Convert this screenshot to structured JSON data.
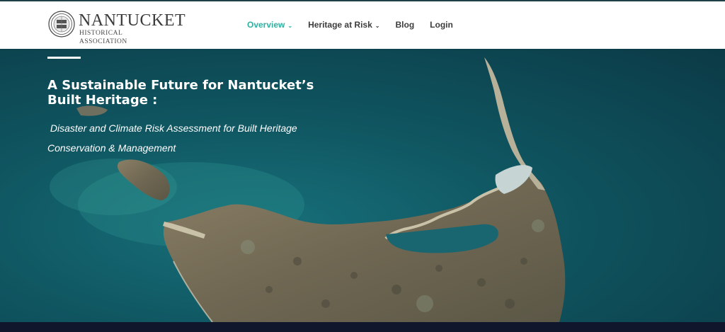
{
  "brand": {
    "name": "NANTUCKET",
    "subtitle": "HISTORICAL ASSOCIATION",
    "seal_icon": "nha-seal-icon"
  },
  "nav": {
    "items": [
      {
        "label": "Overview",
        "dropdown": true,
        "active": true
      },
      {
        "label": "Heritage at Risk",
        "dropdown": true,
        "active": false
      },
      {
        "label": "Blog",
        "dropdown": false,
        "active": false
      },
      {
        "label": "Login",
        "dropdown": false,
        "active": false
      }
    ]
  },
  "hero": {
    "title": "A Sustainable Future for Nantucket’s Built Heritage :",
    "subtitle_line1": " Disaster and Climate Risk Assessment for Built Heritage",
    "subtitle_line2": "Conservation & Management"
  },
  "colors": {
    "accent": "#2fb0a0",
    "nav_text": "#3d3d3d",
    "sea": "#0c4a52",
    "footer_bar": "#10172c"
  }
}
